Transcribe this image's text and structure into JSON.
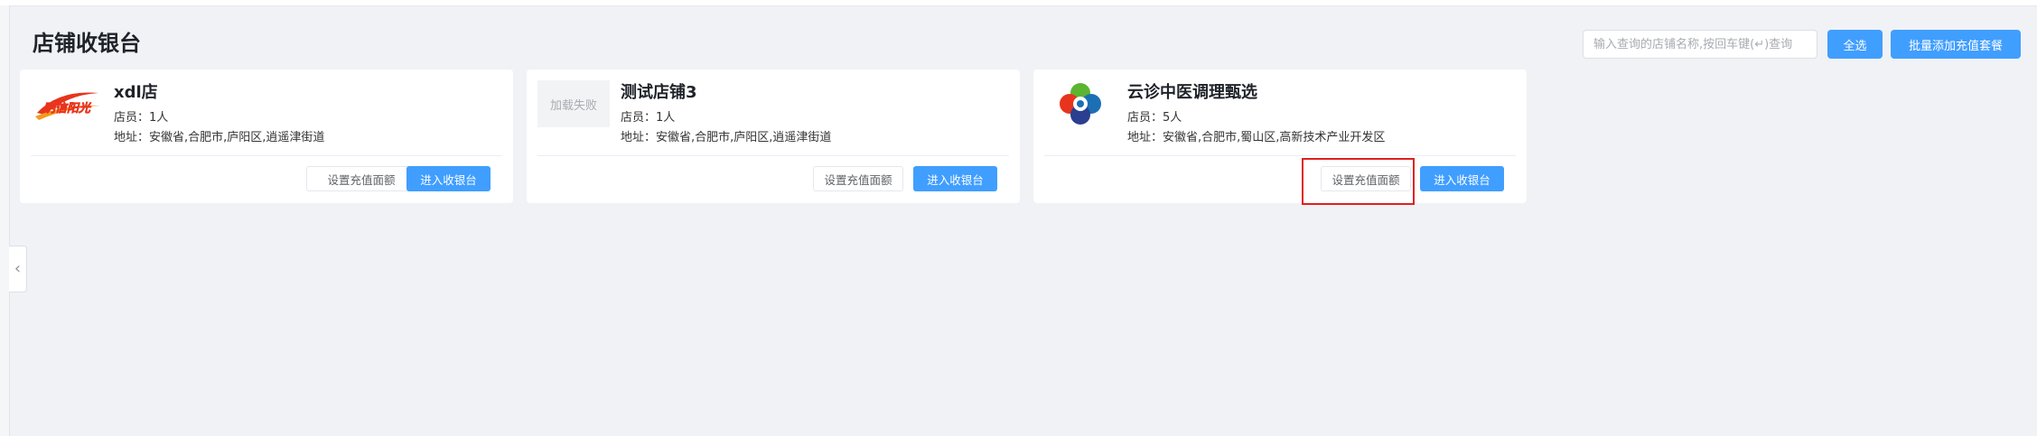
{
  "page": {
    "title": "店铺收银台"
  },
  "toolbar": {
    "search_placeholder": "输入查询的店铺名称,按回车键(↵)查询",
    "select_all_label": "全选",
    "batch_add_label": "批量添加充值套餐"
  },
  "stores": [
    {
      "name": "xdl店",
      "logo_text": "明信阳光",
      "staff": "店员：1人",
      "address": "地址：安徽省,合肥市,庐阳区,逍遥津街道",
      "set_recharge_label": "设置充值面额",
      "enter_label": "进入收银台"
    },
    {
      "name": "测试店铺3",
      "logo_text": "加载失败",
      "staff": "店员：1人",
      "address": "地址：安徽省,合肥市,庐阳区,逍遥津街道",
      "set_recharge_label": "设置充值面额",
      "enter_label": "进入收银台"
    },
    {
      "name": "云诊中医调理甄选",
      "staff": "店员：5人",
      "address": "地址：安徽省,合肥市,蜀山区,高新技术产业开发区",
      "set_recharge_label": "设置充值面额",
      "enter_label": "进入收银台"
    }
  ],
  "colors": {
    "primary": "#409eff",
    "background": "#f0f2f5",
    "highlight": "#e02020",
    "logo_red": "#e8341c",
    "logo_green": "#5bb531",
    "logo_blue": "#1b6fb5"
  },
  "icons": {
    "collapse": "chevron-left-icon"
  }
}
